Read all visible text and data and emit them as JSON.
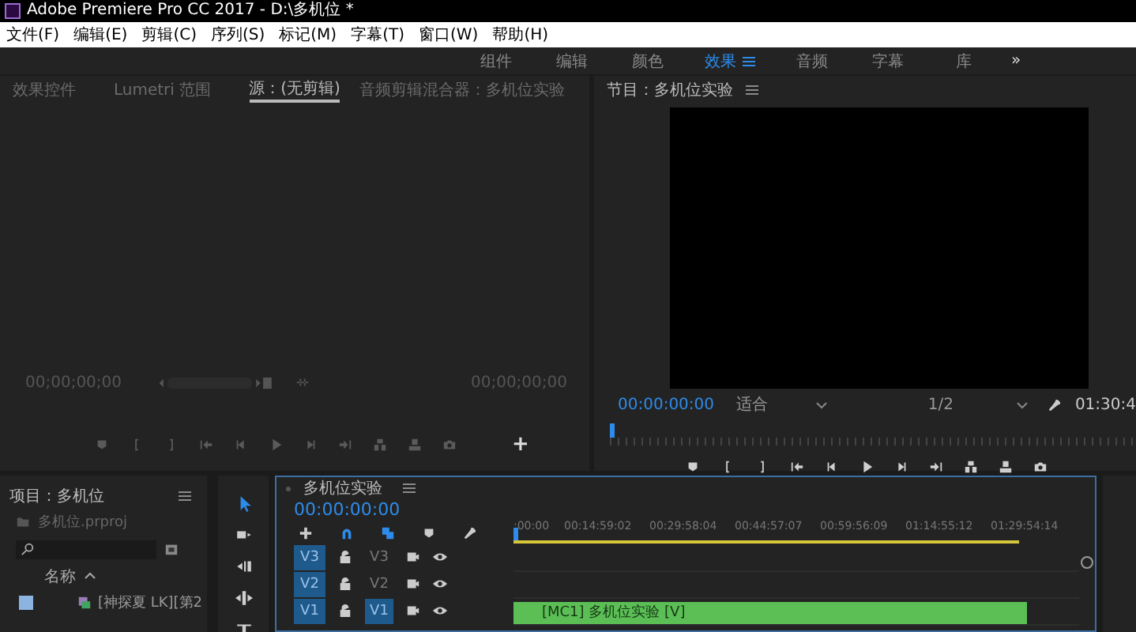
{
  "window": {
    "title": "Adobe Premiere Pro CC 2017 - D:\\多机位 *"
  },
  "menu": [
    "文件(F)",
    "编辑(E)",
    "剪辑(C)",
    "序列(S)",
    "标记(M)",
    "字幕(T)",
    "窗口(W)",
    "帮助(H)"
  ],
  "workspaces": [
    {
      "label": "组件",
      "selected": false
    },
    {
      "label": "编辑",
      "selected": false
    },
    {
      "label": "颜色",
      "selected": false
    },
    {
      "label": "效果",
      "selected": true
    },
    {
      "label": "音频",
      "selected": false
    },
    {
      "label": "字幕",
      "selected": false
    },
    {
      "label": "库",
      "selected": false
    }
  ],
  "workspaces_more": "»",
  "source_panel": {
    "tabs": [
      {
        "label": "效果控件",
        "selected": false
      },
      {
        "label": "Lumetri 范围",
        "selected": false
      },
      {
        "label": "源：(无剪辑)",
        "selected": true
      },
      {
        "label": "音频剪辑混合器：多机位实验",
        "selected": false
      }
    ],
    "timecode_in": "00;00;00;00",
    "timecode_out": "00;00;00;00",
    "add": "+"
  },
  "program_panel": {
    "title": "节目：多机位实验",
    "timecode": "00:00:00:00",
    "zoom": "适合",
    "resolution": "1/2",
    "duration": "01:30:4"
  },
  "project_panel": {
    "title": "项目：多机位",
    "file": "多机位.prproj",
    "column": "名称",
    "items": [
      {
        "name": "[神探夏 LK][第2"
      }
    ]
  },
  "timeline": {
    "title": "多机位实验",
    "timecode": "00:00:00:00",
    "ruler": [
      ":00:00",
      "00:14:59:02",
      "00:29:58:04",
      "00:44:57:07",
      "00:59:56:09",
      "01:14:55:12",
      "01:29:54:14"
    ],
    "tracks": [
      {
        "patch": "V3",
        "name": "V3",
        "targeted": false
      },
      {
        "patch": "V2",
        "name": "V2",
        "targeted": false
      },
      {
        "patch": "V1",
        "name": "V1",
        "targeted": true,
        "clip": "[MC1] 多机位实验 [V]"
      }
    ]
  }
}
